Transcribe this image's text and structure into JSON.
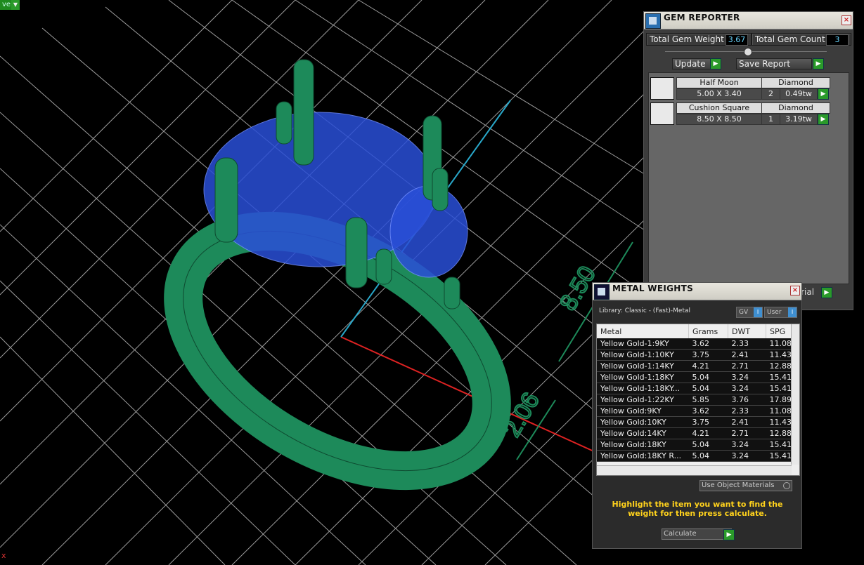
{
  "corner_tab": {
    "label": "ve"
  },
  "viewport": {
    "axis_label": "x",
    "dimension_labels": [
      "8.50",
      "2.06"
    ]
  },
  "gem_reporter": {
    "title": "GEM REPORTER",
    "total_weight_label": "Total Gem Weight",
    "total_weight_value": "3.67",
    "total_count_label": "Total Gem Count",
    "total_count_value": "3",
    "update_label": "Update",
    "save_report_label": "Save Report",
    "partial_button_label": "terial",
    "gems": [
      {
        "cut": "Half Moon",
        "material": "Diamond",
        "size": "5.00 X 3.40",
        "count": "2",
        "weight": "0.49tw"
      },
      {
        "cut": "Cushion Square",
        "material": "Diamond",
        "size": "8.50 X 8.50",
        "count": "1",
        "weight": "3.19tw"
      }
    ]
  },
  "metal_weights": {
    "title": "METAL WEIGHTS",
    "library": "Library: Classic - (Fast)-Metal",
    "toggle_gv": "GV",
    "toggle_user": "User",
    "columns": [
      "Metal",
      "Grams",
      "DWT",
      "SPG"
    ],
    "rows": [
      [
        "Yellow Gold-1:9KY",
        "3.62",
        "2.33",
        "11.08"
      ],
      [
        "Yellow Gold-1:10KY",
        "3.75",
        "2.41",
        "11.43"
      ],
      [
        "Yellow Gold-1:14KY",
        "4.21",
        "2.71",
        "12.88"
      ],
      [
        "Yellow Gold-1:18KY",
        "5.04",
        "3.24",
        "15.41"
      ],
      [
        "Yellow Gold-1:18KY...",
        "5.04",
        "3.24",
        "15.41"
      ],
      [
        "Yellow Gold-1:22KY",
        "5.85",
        "3.76",
        "17.89"
      ],
      [
        "Yellow Gold:9KY",
        "3.62",
        "2.33",
        "11.08"
      ],
      [
        "Yellow Gold:10KY",
        "3.75",
        "2.41",
        "11.43"
      ],
      [
        "Yellow Gold:14KY",
        "4.21",
        "2.71",
        "12.88"
      ],
      [
        "Yellow Gold:18KY",
        "5.04",
        "3.24",
        "15.41"
      ],
      [
        "Yellow Gold:18KY R...",
        "5.04",
        "3.24",
        "15.41"
      ]
    ],
    "use_object_materials": "Use Object Materials",
    "hint": "Highlight the item you want to find the weight for then press calculate.",
    "calculate_label": "Calculate"
  },
  "colors": {
    "ring": "#1d8a5a",
    "gem": "#2a4fd8",
    "accent": "#2a9a2a"
  }
}
